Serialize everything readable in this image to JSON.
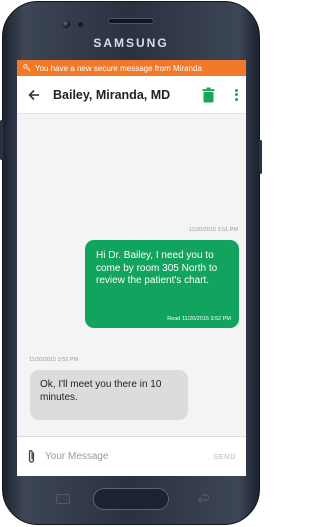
{
  "device": {
    "brand": "SAMSUNG"
  },
  "notification": {
    "text": "You have a new secure message from Miranda"
  },
  "header": {
    "title": "Bailey, Miranda, MD"
  },
  "thread": {
    "outgoing": {
      "timestamp": "11/20/2015 3:51 PM",
      "text": "Hi Dr. Bailey, I need you to come by room 305 North to review the patient's chart.",
      "read_receipt": "Read 11/20/2015 3:52 PM"
    },
    "incoming": {
      "timestamp": "11/20/2015 3:52 PM",
      "text": "Ok, I'll meet you there in 10 minutes."
    }
  },
  "composer": {
    "placeholder": "Your Message",
    "send_label": "SEND"
  },
  "icons": {
    "notification": "key-icon",
    "back": "back-arrow-icon",
    "delete": "trash-icon",
    "menu": "more-vertical-icon",
    "attach": "paperclip-icon"
  },
  "colors": {
    "accent": "#12a35e",
    "notification": "#f07a2a",
    "incoming_bubble": "#dcdcdc",
    "outgoing_bubble": "#12a35e",
    "thread_bg": "#f4f4f4"
  }
}
